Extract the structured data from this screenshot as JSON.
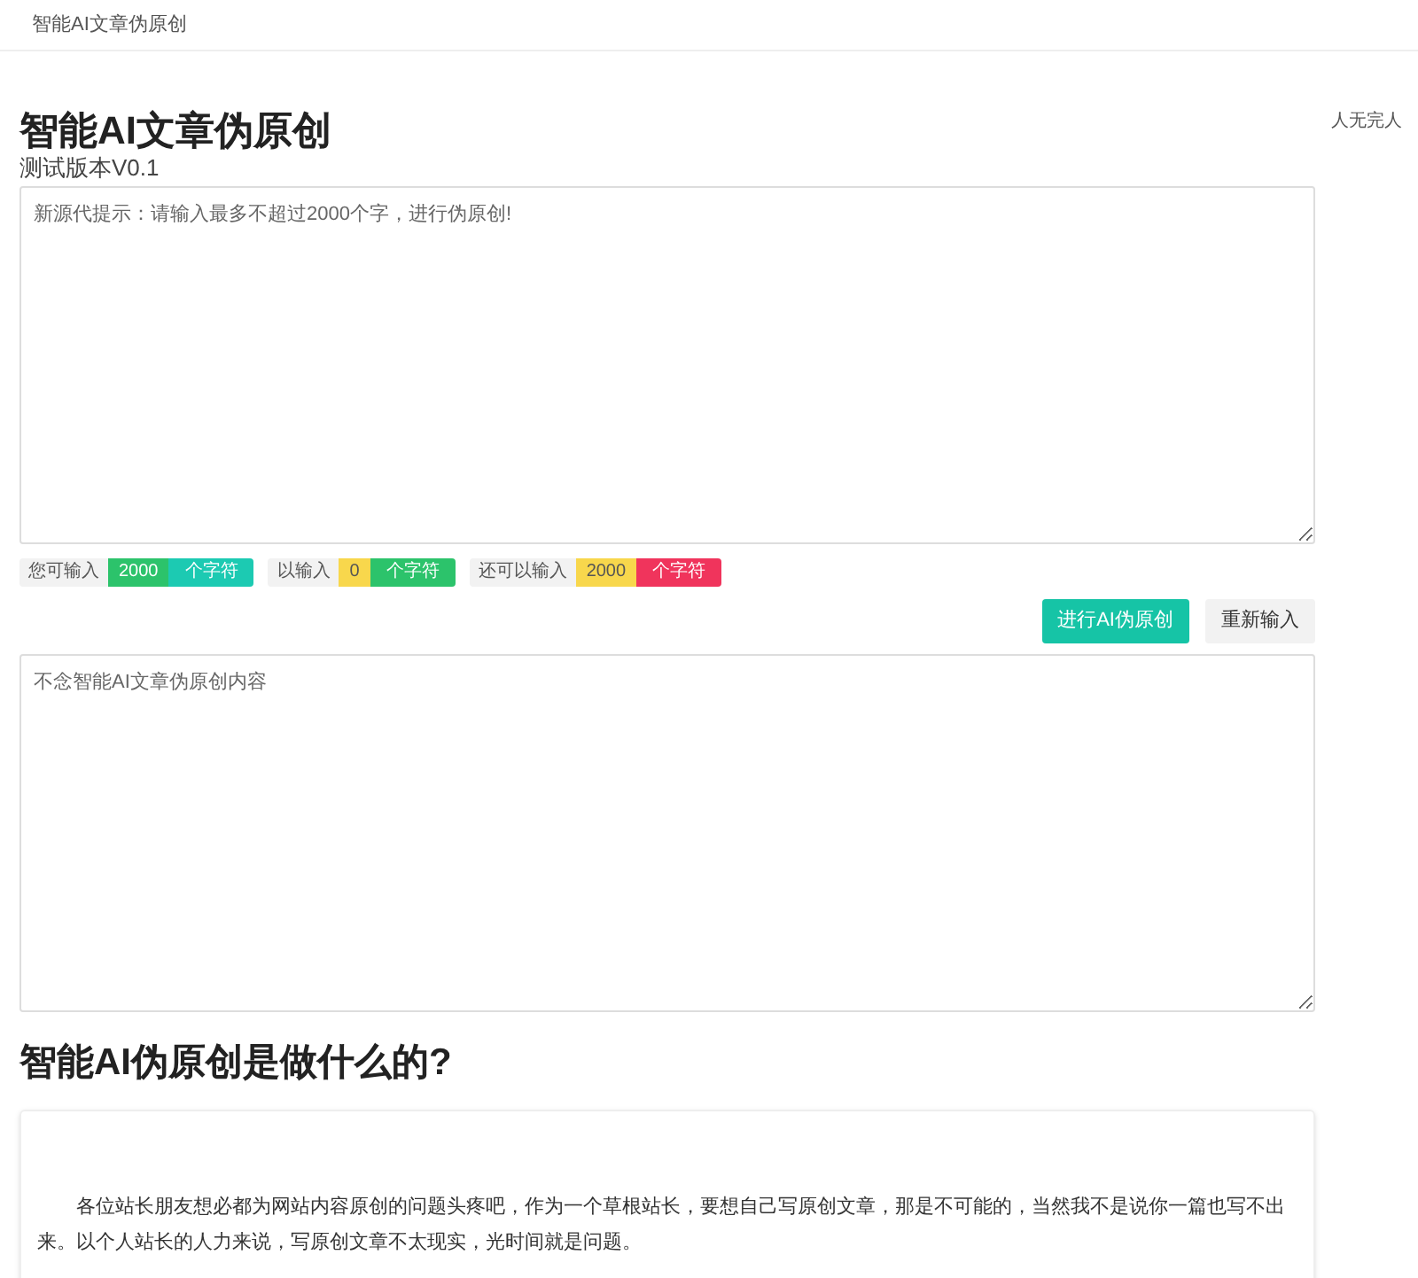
{
  "nav": {
    "title": "智能AI文章伪原创"
  },
  "header": {
    "title": "智能AI文章伪原创",
    "subtitle": "测试版本V0.1"
  },
  "sidebar": {
    "text": "人无完人"
  },
  "input_box": {
    "placeholder": "新源代提示：请输入最多不超过2000个字，进行伪原创!"
  },
  "counters": [
    {
      "label": "您可输入",
      "value": {
        "text": "2000",
        "color": "#2cc36b"
      },
      "unit": {
        "text": "个字符",
        "color": "#1ccab2"
      }
    },
    {
      "label": "以输入",
      "value": {
        "text": "0",
        "color": "#f8d74c"
      },
      "unit": {
        "text": "个字符",
        "color": "#2cc36b"
      }
    },
    {
      "label": "还可以输入",
      "value": {
        "text": "2000",
        "color": "#f8d74c"
      },
      "unit": {
        "text": "个字符",
        "color": "#f0345c"
      }
    }
  ],
  "buttons": [
    {
      "label": "进行AI伪原创",
      "kind": "primary"
    },
    {
      "label": "重新输入",
      "kind": "secondary"
    }
  ],
  "output_box": {
    "placeholder": "不念智能AI文章伪原创内容"
  },
  "about": {
    "title": "智能AI伪原创是做什么的?",
    "paragraph": "各位站长朋友想必都为网站内容原创的问题头疼吧，作为一个草根站长，要想自己写原创文章，那是不可能的，当然我不是说你一篇也写不出来。以个人站长的人力来说，写原创文章不太现实，光时间就是问题。"
  }
}
